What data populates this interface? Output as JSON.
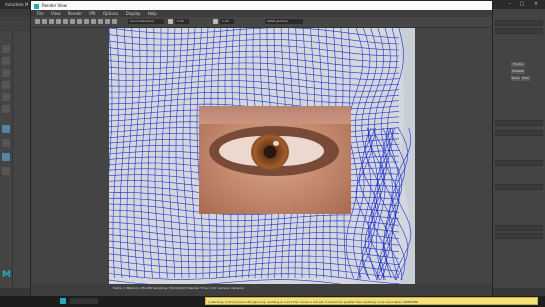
{
  "maya_main": {
    "title": "Autodesk M",
    "logo": "M"
  },
  "render_view": {
    "title": "Render View",
    "menus": [
      "File",
      "View",
      "Render",
      "IPR",
      "Options",
      "Display",
      "Help"
    ],
    "toolbar": {
      "camera": "persp",
      "renderer": "Arnold Renderer",
      "val1": "0.00",
      "val2": "1.00",
      "colorspace": "sRGB gamma"
    },
    "status_caption": "frame: 1   Memory: 251 Mb   Sampling: [3/2/2/2/2/2]   Render Time: 0:11   Camera: camera1"
  },
  "right_panel": {
    "buttons": [
      "Frame",
      "Presets",
      "Show",
      "Hide"
    ]
  },
  "warning": {
    "text": "// Warning: [mtoa] [openvdb] Ignoring: padding is 0 and FILL mode is not set; it should be greater than padding: 0 (is redundant) ANIMATED"
  },
  "colors": {
    "mesh": "#2232c8",
    "maya_accent": "#23a9b8",
    "warning_bg": "#f5e27a"
  }
}
